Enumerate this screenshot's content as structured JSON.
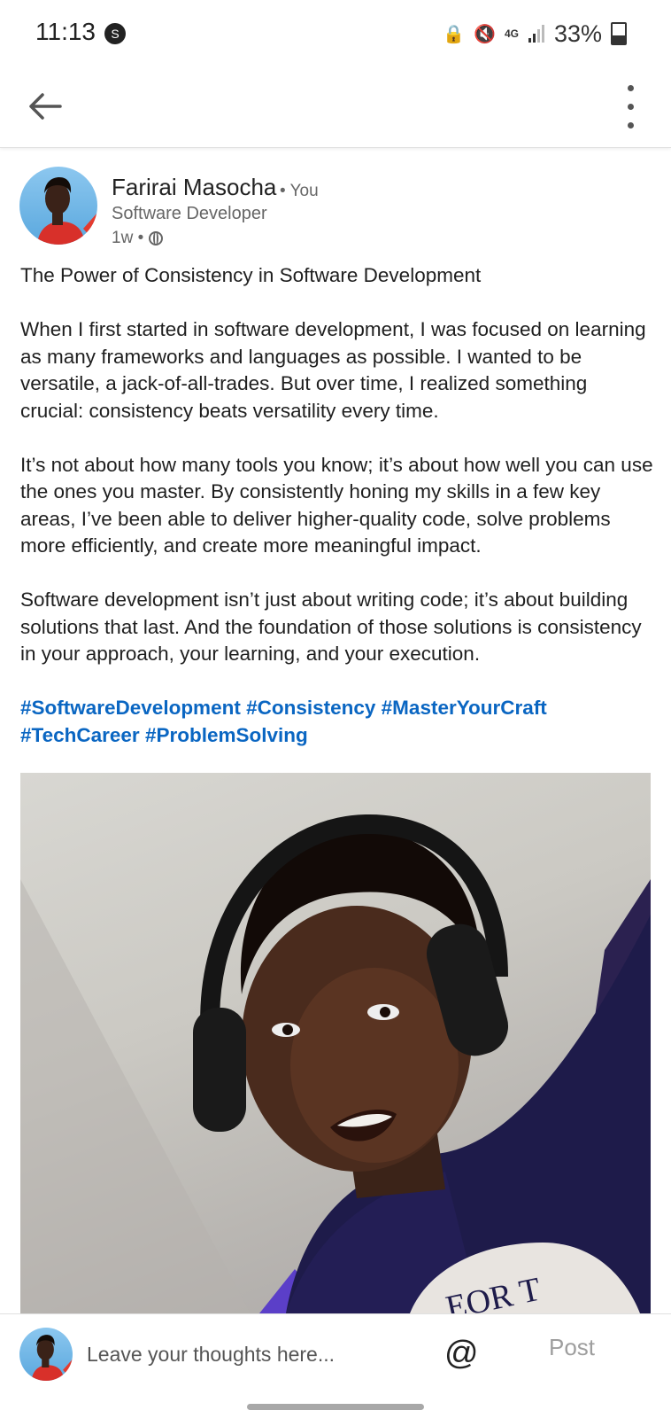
{
  "status_bar": {
    "time": "11:13",
    "network": "4G",
    "battery": "33%"
  },
  "app_bar": {
    "back_icon": "arrow-left-icon",
    "menu_icon": "more-vertical-icon"
  },
  "post": {
    "author": {
      "name": "Farirai Masocha",
      "you_tag": "• You",
      "headline": "Software Developer",
      "time_ago": "1w •",
      "visibility_icon": "globe-icon"
    },
    "title": "The Power of Consistency in Software Development",
    "paragraphs": [
      "When I first started in software development, I was focused on learning as many frameworks and languages as possible. I wanted to be versatile, a jack-of-all-trades. But over time, I realized something crucial: consistency beats versatility every time.",
      "It’s not about how many tools you know; it’s about how well you can use the ones you master. By consistently honing my skills in a few key areas, I’ve been able to deliver higher-quality code, solve problems more efficiently, and create more meaningful impact.",
      "Software development isn’t just about writing code; it’s about building solutions that last. And the foundation of those solutions is consistency in your approach, your learning, and your execution."
    ],
    "hashtags": [
      "#SoftwareDevelopment",
      "#Consistency",
      "#MasterYourCraft",
      "#TechCareer",
      "#ProblemSolving"
    ],
    "image_text": "EOR T"
  },
  "comment_bar": {
    "placeholder": "Leave your thoughts here...",
    "mention_label": "@",
    "post_label": "Post"
  },
  "colors": {
    "link": "#0a66c2",
    "text": "#1f1f1f",
    "muted": "#666666",
    "post_disabled": "#9e9e9e"
  }
}
